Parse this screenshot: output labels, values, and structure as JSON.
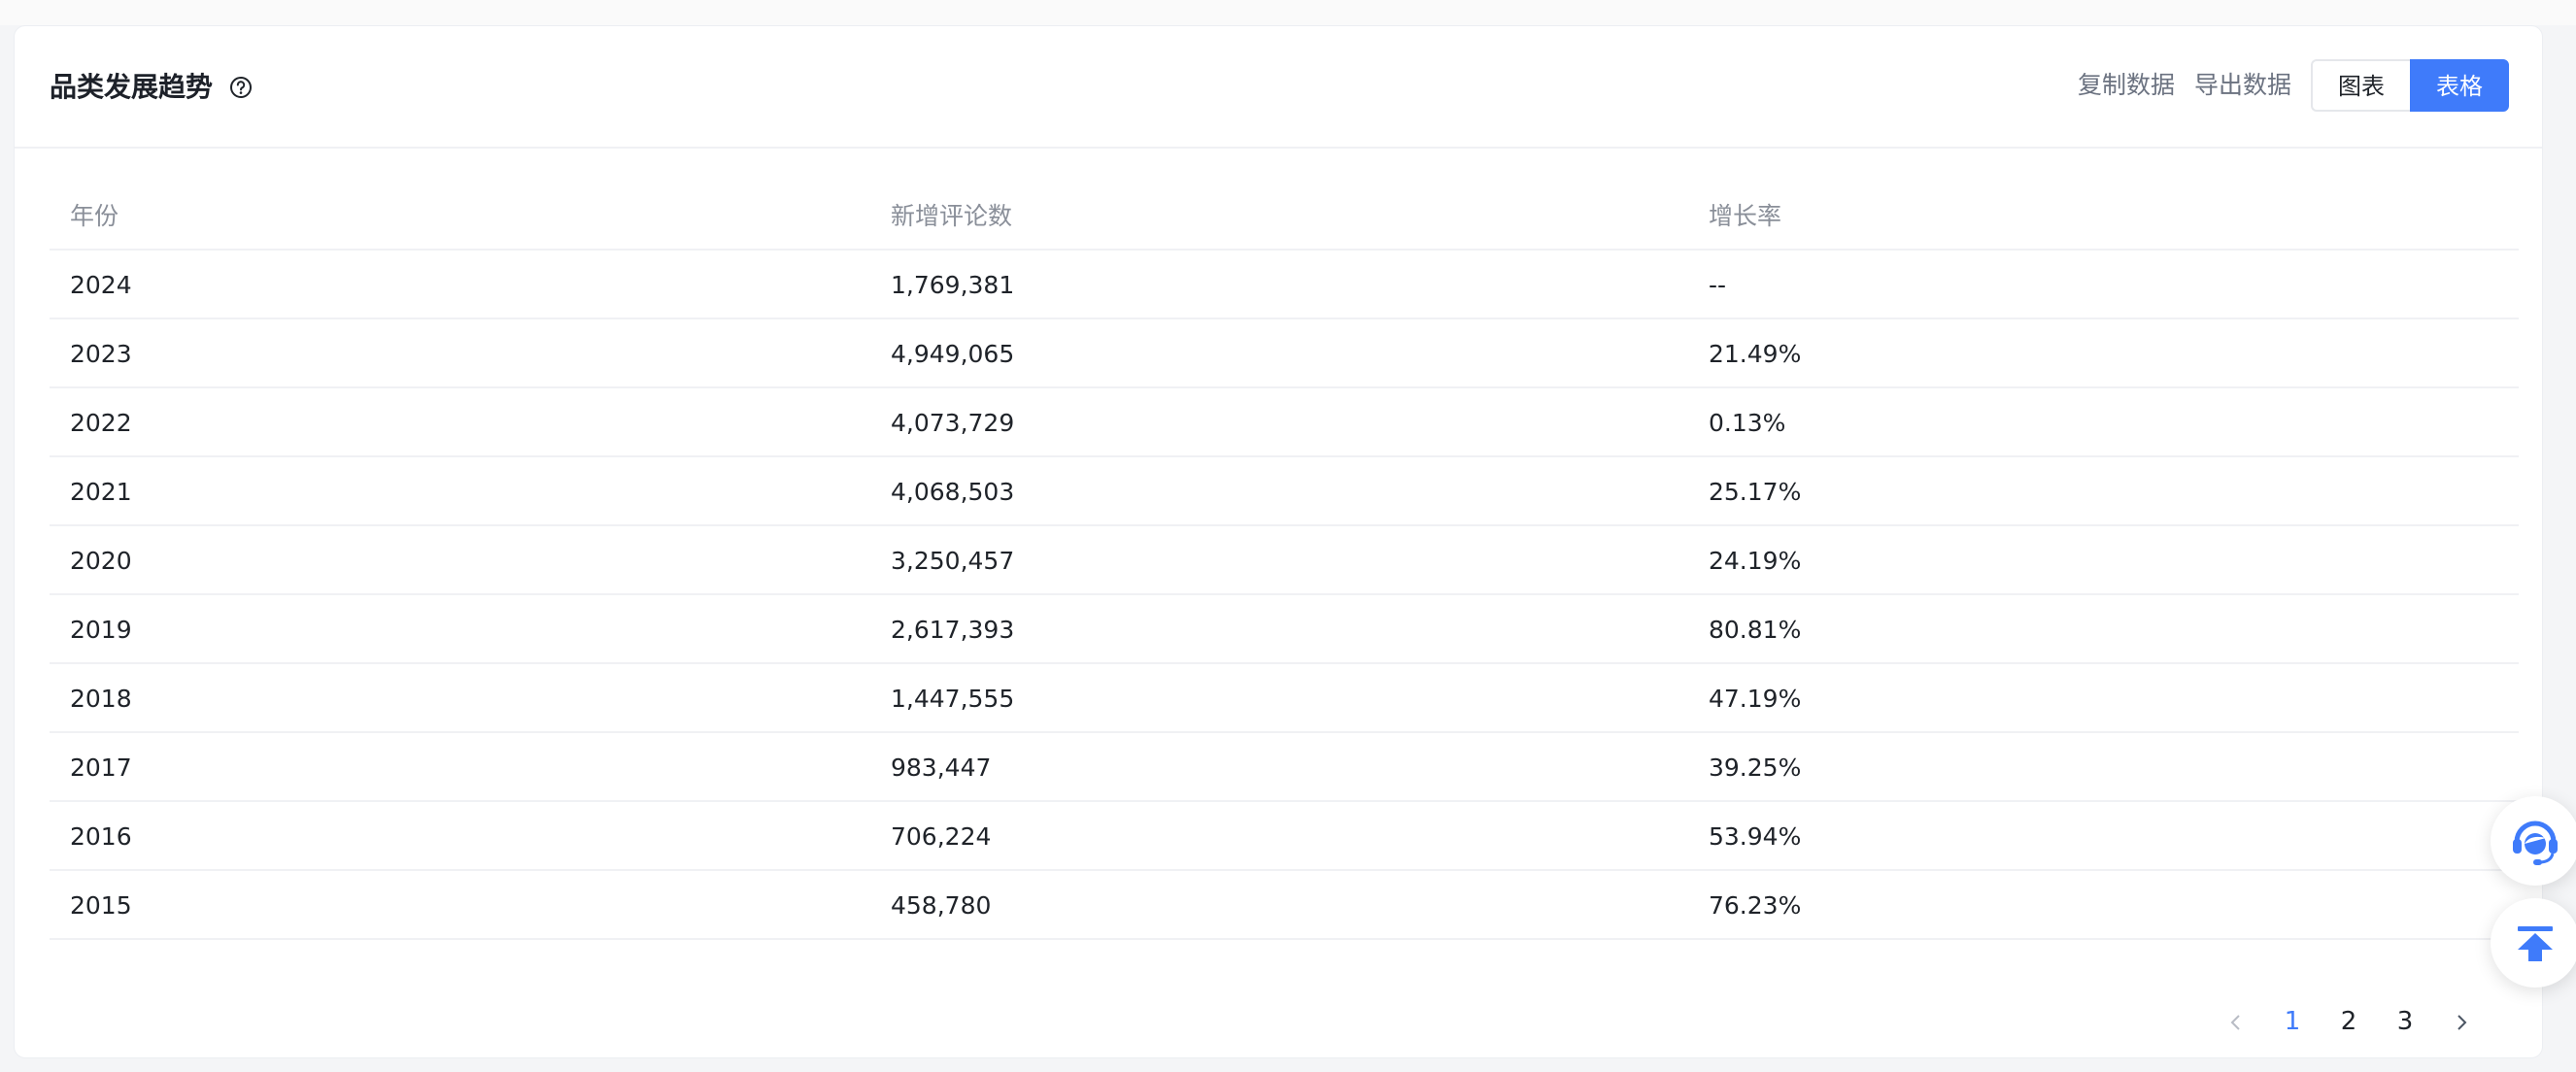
{
  "card": {
    "title": "品类发展趋势",
    "actions": {
      "copy": "复制数据",
      "export": "导出数据",
      "chart": "图表",
      "table": "表格"
    }
  },
  "table": {
    "headers": [
      "年份",
      "新增评论数",
      "增长率"
    ],
    "rows": [
      [
        "2024",
        "1,769,381",
        "--"
      ],
      [
        "2023",
        "4,949,065",
        "21.49%"
      ],
      [
        "2022",
        "4,073,729",
        "0.13%"
      ],
      [
        "2021",
        "4,068,503",
        "25.17%"
      ],
      [
        "2020",
        "3,250,457",
        "24.19%"
      ],
      [
        "2019",
        "2,617,393",
        "80.81%"
      ],
      [
        "2018",
        "1,447,555",
        "47.19%"
      ],
      [
        "2017",
        "983,447",
        "39.25%"
      ],
      [
        "2016",
        "706,224",
        "53.94%"
      ],
      [
        "2015",
        "458,780",
        "76.23%"
      ]
    ]
  },
  "pagination": {
    "pages": [
      "1",
      "2",
      "3"
    ],
    "current": "1"
  },
  "colors": {
    "accent": "#3f7bfa",
    "muted_text": "#8a8f99",
    "divider": "#f0f1f4"
  },
  "icons": {
    "help": "question-circle-icon",
    "service": "customer-service-icon",
    "back_to_top": "arrow-up-to-top-icon",
    "prev": "chevron-left-icon",
    "next": "chevron-right-icon"
  }
}
